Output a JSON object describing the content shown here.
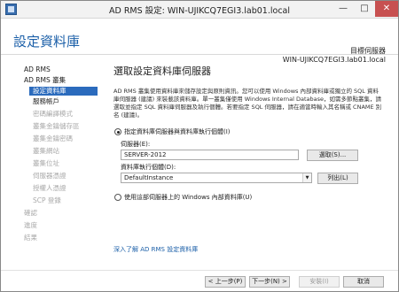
{
  "window": {
    "title": "AD RMS 設定: WIN-UJIKCQ7EGI3.lab01.local",
    "icon": "ad-rms-icon",
    "controls": [
      "—",
      "□",
      "✕"
    ]
  },
  "header": {
    "page_title": "設定資料庫",
    "target_label": "目標伺服器",
    "target_server": "WIN-UJIKCQ7EGI3.lab01.local"
  },
  "nav": {
    "items": [
      {
        "label": "AD RMS",
        "state": "normal",
        "level": 0
      },
      {
        "label": "AD RMS 叢集",
        "state": "normal",
        "level": 0
      },
      {
        "label": "設定資料庫",
        "state": "selected",
        "level": 1
      },
      {
        "label": "服務帳戶",
        "state": "normal",
        "level": 1
      },
      {
        "label": "密碼編譯模式",
        "state": "disabled",
        "level": 1
      },
      {
        "label": "叢集金鑰儲存區",
        "state": "disabled",
        "level": 1
      },
      {
        "label": "叢集金鑰密碼",
        "state": "disabled",
        "level": 1
      },
      {
        "label": "叢集網站",
        "state": "disabled",
        "level": 1
      },
      {
        "label": "叢集位址",
        "state": "disabled",
        "level": 1
      },
      {
        "label": "伺服器憑證",
        "state": "disabled",
        "level": 1
      },
      {
        "label": "授權人憑證",
        "state": "disabled",
        "level": 1
      },
      {
        "label": "SCP 登錄",
        "state": "disabled",
        "level": 1
      },
      {
        "label": "確認",
        "state": "disabled",
        "level": 0
      },
      {
        "label": "進度",
        "state": "disabled",
        "level": 0
      },
      {
        "label": "結果",
        "state": "disabled",
        "level": 0
      }
    ]
  },
  "main": {
    "section_title": "選取設定資料庫伺服器",
    "description": "AD RMS 叢集使用資料庫來儲存設定與原則資訊。您可以使用 Windows 內部資料庫或獨立的 SQL 資料庫伺服器 (建議) 來裝載該資料庫。單一叢集僅使用 Windows Internal Database，如需多節點叢集，請選取並指定 SQL 資料庫伺服器及執行個體。若要指定 SQL 伺服器，請在適當時輸入其名稱或 CNAME 別名 (建議)。",
    "option_sql_label": "指定資料庫伺服器與資料庫執行個體(I)",
    "option_sql_selected": true,
    "server_label": "伺服器(E):",
    "server_value": "SERVER-2012",
    "browse_button": "選取(S)...",
    "instance_label": "資料庫執行個體(D):",
    "instance_value": "DefaultInstance",
    "list_button": "列出(L)",
    "option_internal_label": "使用這部伺服器上的 Windows 內部資料庫(U)",
    "option_internal_selected": false,
    "help_link": "深入了解 AD RMS 設定資料庫"
  },
  "footer": {
    "back": "< 上一步(P)",
    "next": "下一步(N) >",
    "install": "安裝(I)",
    "cancel": "取消"
  }
}
